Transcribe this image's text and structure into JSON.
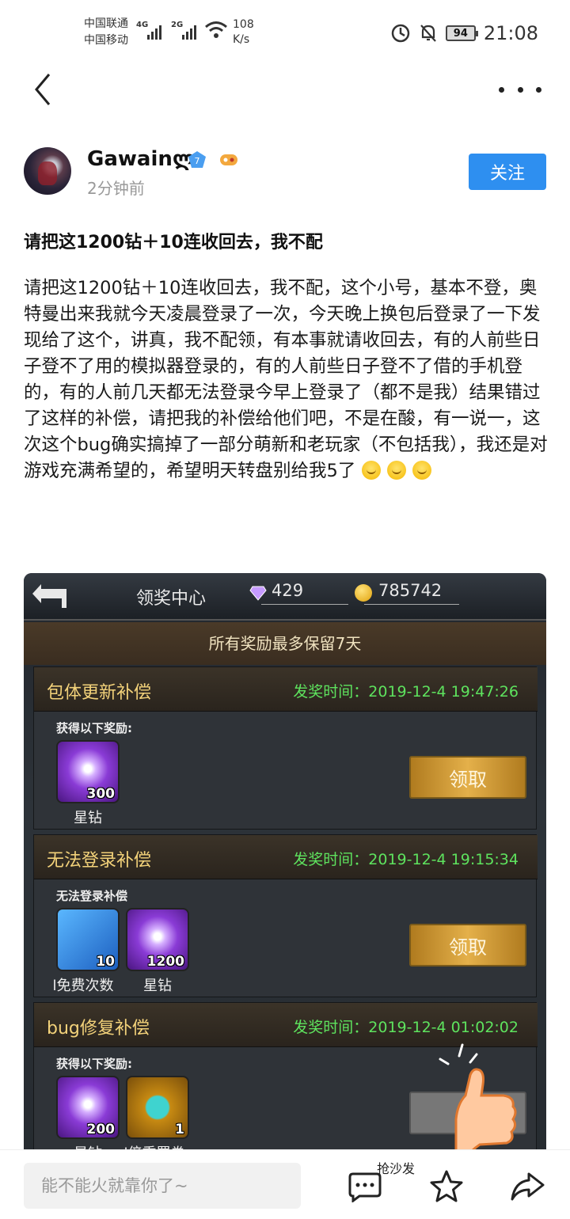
{
  "status_bar": {
    "carrier1": "中国联通",
    "carrier2": "中国移动",
    "net1": "4G",
    "net2": "2G",
    "speed_value": "108",
    "speed_unit": "K/s",
    "battery": "94",
    "time": "21:08"
  },
  "author": {
    "name": "Gawainლ",
    "verify_level": "7",
    "posted": "2分钟前",
    "follow_label": "关注"
  },
  "post": {
    "title": "请把这1200钻＋10连收回去，我不配",
    "body": "请把这1200钻＋10连收回去，我不配，这个小号，基本不登，奥特曼出来我就今天凌晨登录了一次，今天晚上换包后登录了一下发现给了这个，讲真，我不配领，有本事就请收回去，有的人前些日子登不了用的模拟器登录的，有的人前些日子登不了借的手机登的，有的人前几天都无法登录今早上登录了（都不是我）结果错过了这样的补偿，请把我的补偿给他们吧，不是在酸，有一说一，这次这个bug确实搞掉了一部分萌新和老玩家（不包括我），我还是对游戏充满希望的，希望明天转盘别给我5了"
  },
  "game": {
    "header": "领奖中心",
    "gems": "429",
    "coins": "785742",
    "notice": "所有奖励最多保留7天",
    "cards": [
      {
        "title": "包体更新补偿",
        "time": "发奖时间：2019-12-4 19:47:26",
        "sub": "获得以下奖励:",
        "items": [
          {
            "count": "300",
            "name": "星钻",
            "color": "purple"
          }
        ],
        "claim": "领取"
      },
      {
        "title": "无法登录补偿",
        "time": "发奖时间：2019-12-4 19:15:34",
        "sub": "无法登录补偿",
        "items": [
          {
            "count": "10",
            "name": "l免费次数",
            "color": "blue"
          },
          {
            "count": "1200",
            "name": "星钻",
            "color": "purple"
          }
        ],
        "claim": "领取"
      },
      {
        "title": "bug修复补偿",
        "time": "发奖时间：2019-12-4 01:02:02",
        "sub": "获得以下奖励:",
        "items": [
          {
            "count": "200",
            "name": "星钻",
            "color": "purple"
          },
          {
            "count": "1",
            "name": "l倍重置卷",
            "color": "gold"
          }
        ],
        "claim": ""
      }
    ]
  },
  "bottom": {
    "comment_placeholder": "能不能火就靠你了~",
    "sofa_label": "抢沙发"
  }
}
